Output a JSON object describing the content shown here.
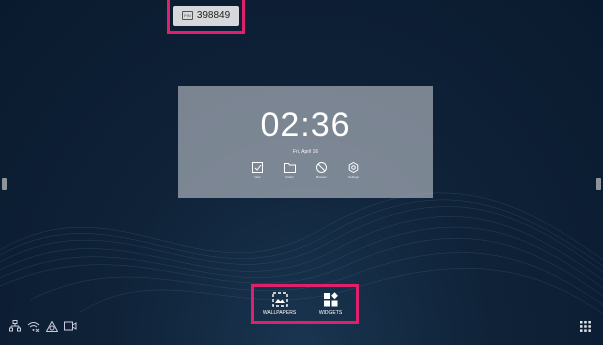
{
  "pin": {
    "code": "398849",
    "icon": "pin-icon"
  },
  "clock": {
    "time": "02:36",
    "date": "Fri, April 16"
  },
  "apps": [
    {
      "label": "Note",
      "icon": "note-icon"
    },
    {
      "label": "Finder",
      "icon": "folder-icon"
    },
    {
      "label": "Browser",
      "icon": "browser-icon"
    },
    {
      "label": "Settings",
      "icon": "settings-icon"
    }
  ],
  "bottom_menu": {
    "wallpapers_label": "WALLPAPERS",
    "widgets_label": "WIDGETS"
  },
  "status_icons": [
    "network-icon",
    "wifi-off-icon",
    "eye-icon",
    "video-icon"
  ],
  "colors": {
    "highlight": "#e0206a",
    "background": "#0f2238"
  }
}
